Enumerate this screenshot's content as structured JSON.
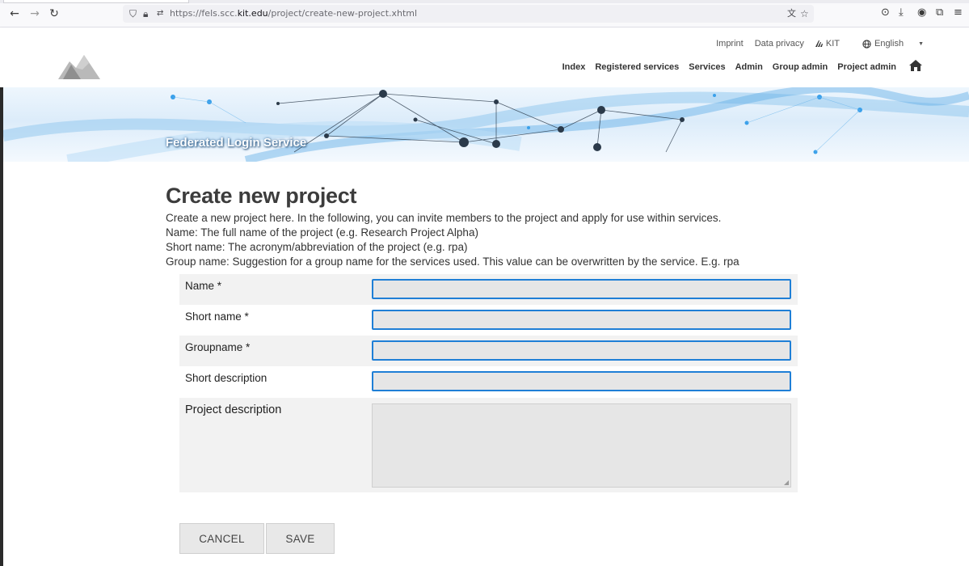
{
  "browser": {
    "url_prefix": "https://fels.scc.",
    "url_host": "kit.edu",
    "url_path": "/project/create-new-project.xhtml",
    "back_glyph": "←",
    "forward_glyph": "→",
    "reload_glyph": "↻"
  },
  "header": {
    "util_links": [
      "Imprint",
      "Data privacy",
      "KIT"
    ],
    "language": "English",
    "nav": [
      "Index",
      "Registered services",
      "Services",
      "Admin",
      "Group admin",
      "Project admin"
    ]
  },
  "banner": {
    "title": "Federated Login Service"
  },
  "page": {
    "title": "Create new project",
    "intro": [
      "Create a new project here. In the following, you can invite members to the project and apply for use within services.",
      "Name: The full name of the project (e.g. Research Project Alpha)",
      "Short name: The acronym/abbreviation of the project (e.g. rpa)",
      "Group name: Suggestion for a group name for the services used. This value can be overwritten by the service. E.g. rpa"
    ]
  },
  "form": {
    "name_label": "Name  *",
    "short_name_label": "Short name  *",
    "groupname_label": "Groupname  *",
    "short_description_label": "Short description",
    "project_description_label": "Project description",
    "name_value": "",
    "short_name_value": "",
    "groupname_value": "",
    "short_description_value": ""
  },
  "buttons": {
    "cancel": "CANCEL",
    "save": "SAVE"
  },
  "colors": {
    "focus_border": "#1f7fd6",
    "row_shade": "#f2f2f2",
    "button_bg": "#e8e8e8"
  }
}
